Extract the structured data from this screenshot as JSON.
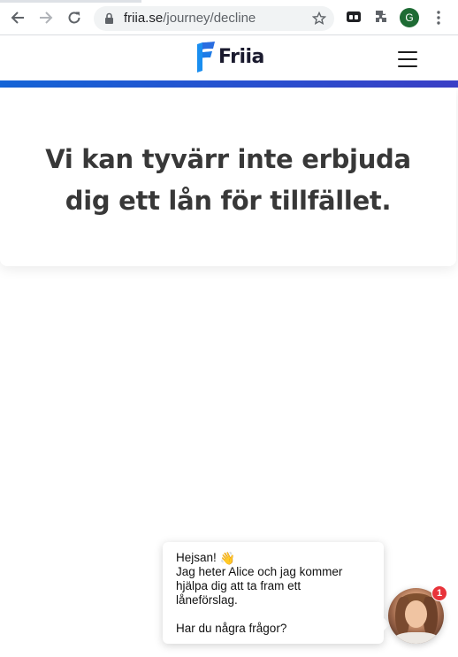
{
  "browser": {
    "url_host": "friia.se",
    "url_path": "/journey/decline",
    "profile_initial": "G"
  },
  "site": {
    "logo_text": "Friia",
    "brand_colors": {
      "gradient_start": "#1565d8",
      "gradient_end": "#3b3fc7",
      "text": "#383838"
    }
  },
  "card": {
    "heading_line1": "Vi kan tyvärr inte erbjuda",
    "heading_line2": "dig ett lån för tillfället."
  },
  "chat": {
    "greeting": "Hejsan!",
    "wave_emoji": "👋",
    "line1": "Jag heter Alice och jag kommer",
    "line2": "hjälpa dig att ta fram ett",
    "line3": "låneförslag.",
    "question": "Har du några frågor?",
    "badge_count": "1"
  },
  "icons": [
    "back-icon",
    "forward-icon",
    "reload-icon",
    "lock-icon",
    "star-icon",
    "tab-search-icon",
    "extensions-icon",
    "kebab-menu-icon",
    "hamburger-icon"
  ]
}
